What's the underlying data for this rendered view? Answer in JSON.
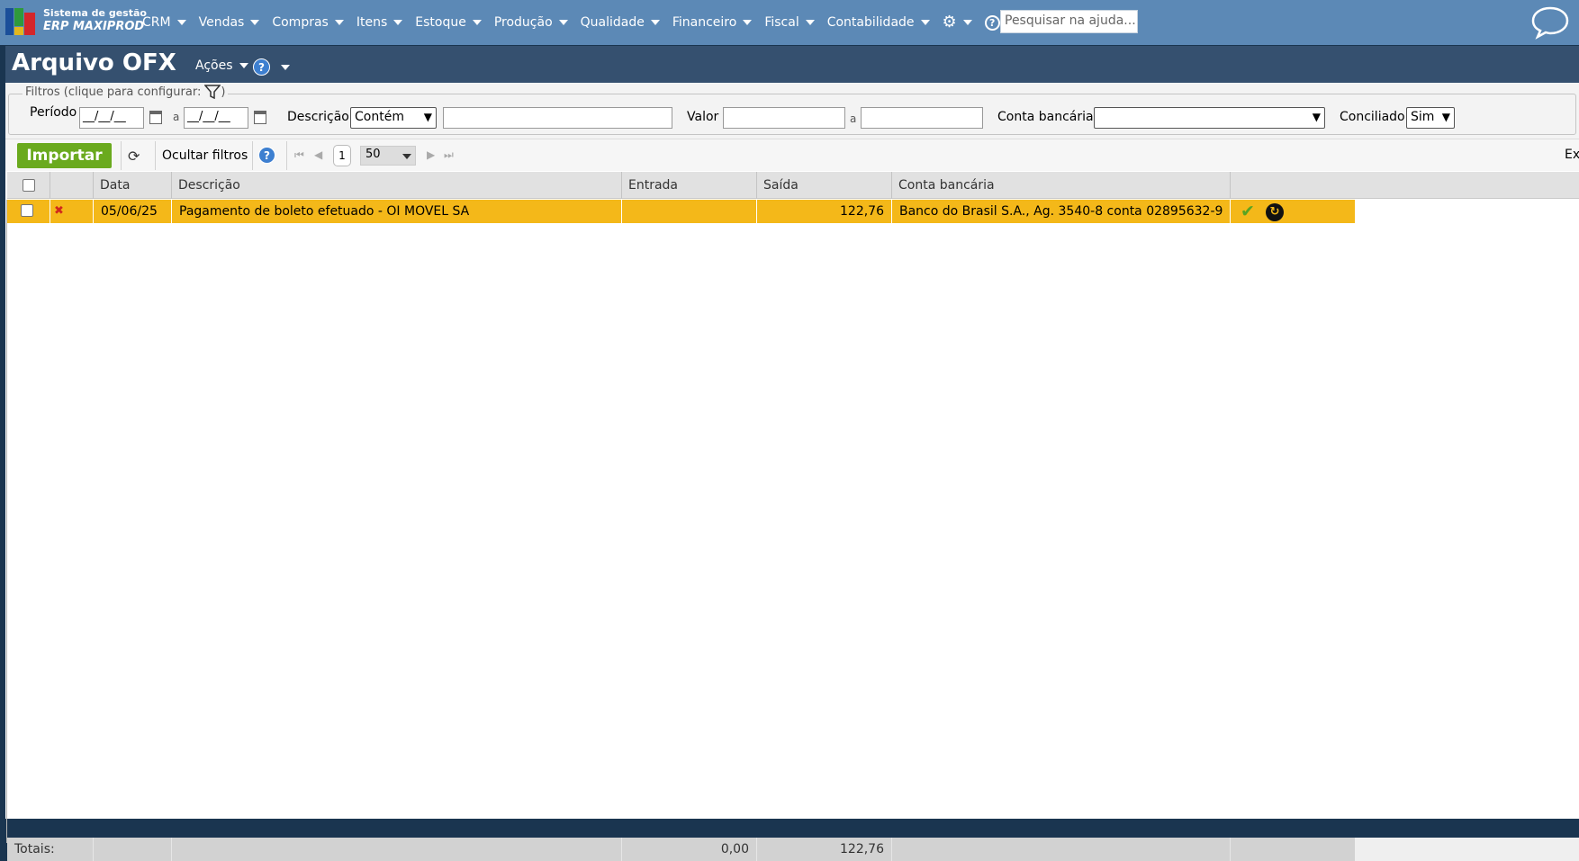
{
  "brand": {
    "line1": "Sistema de gestão",
    "line2": "ERP MAXIPROD"
  },
  "nav": {
    "items": [
      "CRM",
      "Vendas",
      "Compras",
      "Itens",
      "Estoque",
      "Produção",
      "Qualidade",
      "Financeiro",
      "Fiscal",
      "Contabilidade"
    ],
    "search_placeholder": "Pesquisar na ajuda..."
  },
  "page": {
    "title": "Arquivo OFX",
    "actions_label": "Ações"
  },
  "filters": {
    "legend": "Filtros (clique para configurar:",
    "legend_close": ")",
    "periodo_label": "Período",
    "date_from": "__/__/__",
    "date_to": "__/__/__",
    "a_label": "a",
    "descricao_label": "Descrição",
    "descricao_mode": "Contém",
    "descricao_value": "",
    "valor_label": "Valor",
    "valor_from": "",
    "valor_to": "",
    "conta_label": "Conta bancária",
    "conta_value": "",
    "conciliado_label": "Conciliado",
    "conciliado_value": "Sim"
  },
  "toolbar": {
    "import_label": "Importar",
    "hide_filters_label": "Ocultar filtros",
    "page_number": "1",
    "page_size": "50",
    "export_label": "Ex"
  },
  "grid": {
    "columns": [
      "Data",
      "Descrição",
      "Entrada",
      "Saída",
      "Conta bancária"
    ],
    "rows": [
      {
        "data": "05/06/25",
        "descricao": "Pagamento de boleto efetuado - OI MOVEL SA",
        "entrada": "",
        "saida": "122,76",
        "conta": "Banco do Brasil S.A., Ag. 3540-8 conta 02895632-9"
      }
    ],
    "totals": {
      "label": "Totais:",
      "entrada": "0,00",
      "saida": "122,76"
    }
  },
  "colors": {
    "topbar": "#5c89b6",
    "titlebar": "#35506f",
    "row_highlight": "#f4b819",
    "import_button": "#6aaa1e"
  },
  "icons": [
    "gear-icon",
    "help-icon",
    "chat-bubble-icon",
    "filter-icon",
    "calendar-icon",
    "refresh-icon",
    "first-page-icon",
    "prev-page-icon",
    "next-page-icon",
    "last-page-icon",
    "delete-icon",
    "check-icon",
    "undo-icon"
  ]
}
